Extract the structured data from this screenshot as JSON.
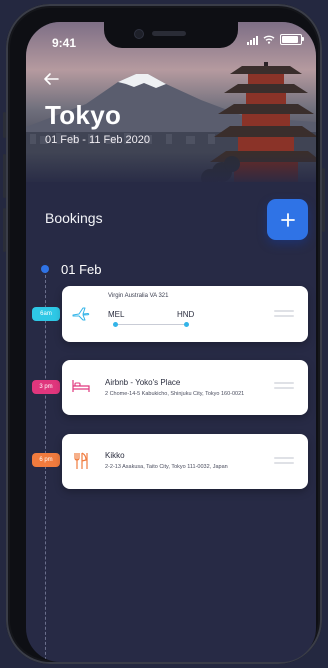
{
  "status_bar": {
    "time": "9:41"
  },
  "trip": {
    "city": "Tokyo",
    "dates": "01 Feb - 11 Feb 2020"
  },
  "bookings": {
    "title": "Bookings",
    "add_label": "+"
  },
  "timeline": {
    "day": "01 Feb",
    "items": [
      {
        "time": "6am",
        "time_color": "#2ec8e6",
        "type": "flight",
        "icon": "plane-icon",
        "name": "Virgin Australia VA 321",
        "from": "MEL",
        "to": "HND"
      },
      {
        "time": "3 pm",
        "time_color": "#e0367d",
        "type": "stay",
        "icon": "bed-icon",
        "title": "Airbnb - Yoko's Place",
        "address": "2 Chome-14-5 Kabukicho, Shinjuku City, Tokyo 160-0021"
      },
      {
        "time": "6 pm",
        "time_color": "#f07b3e",
        "type": "restaurant",
        "icon": "cutlery-icon",
        "title": "Kikko",
        "address": "2-2-13 Asakusa, Taito City, Tokyo 111-0032, Japan"
      }
    ]
  },
  "colors": {
    "accent": "#2f73e6",
    "background": "#272a45",
    "flight_icon": "#33b4e8",
    "stay_icon": "#e0367d",
    "food_icon": "#f07b3e"
  }
}
